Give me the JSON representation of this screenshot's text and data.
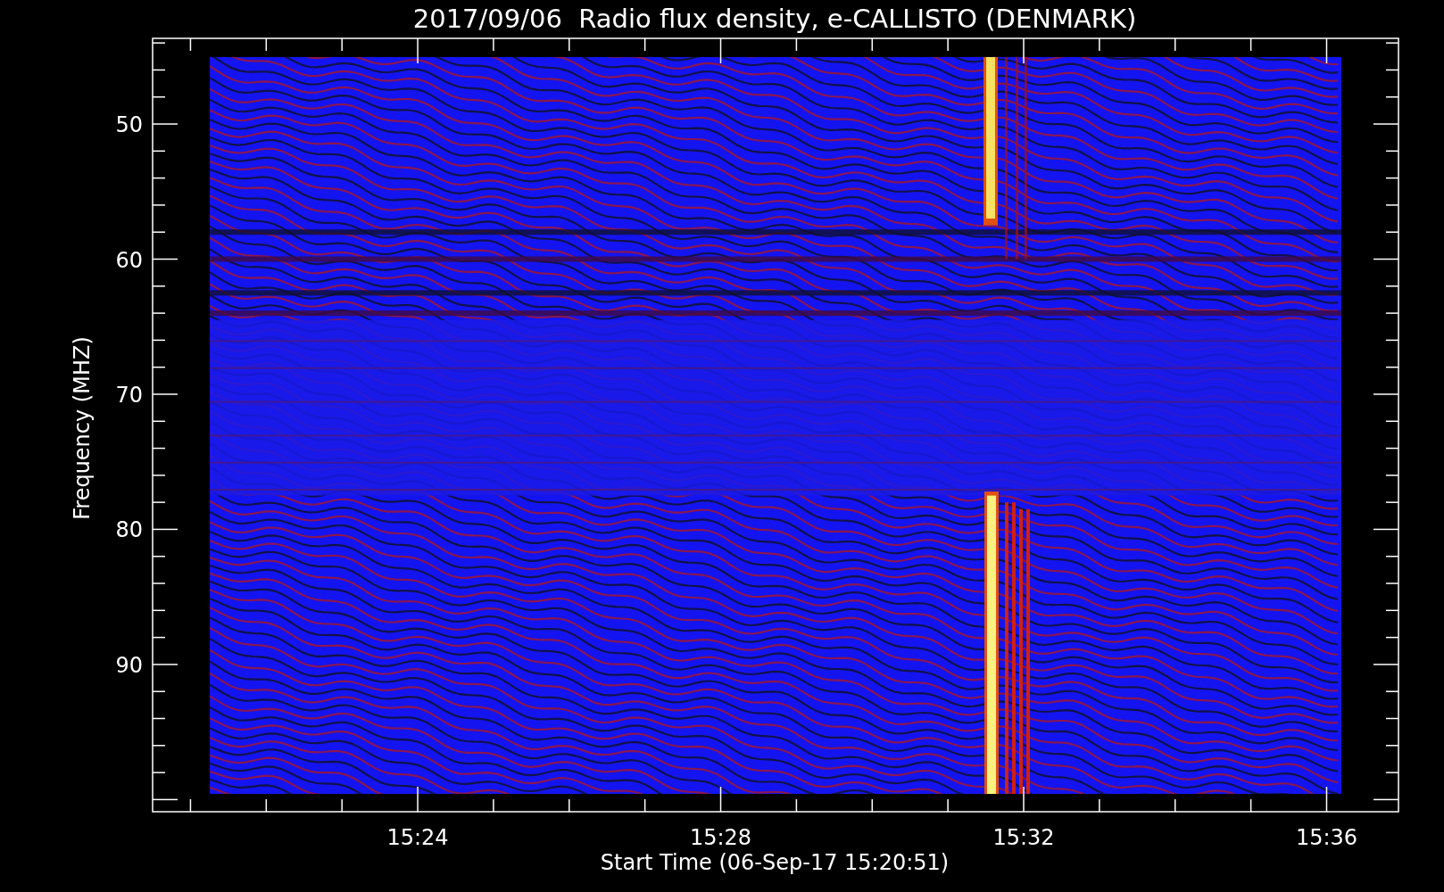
{
  "title": "2017/09/06  Radio flux density, e-CALLISTO (DENMARK)",
  "plot": {
    "ylabel": "Frequency (MHZ)",
    "xlabel": "Start Time (06-Sep-17 15:20:51)",
    "yticks": [
      "50",
      "60",
      "70",
      "80",
      "90"
    ],
    "xticks": [
      "15:24",
      "15:28",
      "15:32",
      "15:36"
    ]
  }
}
